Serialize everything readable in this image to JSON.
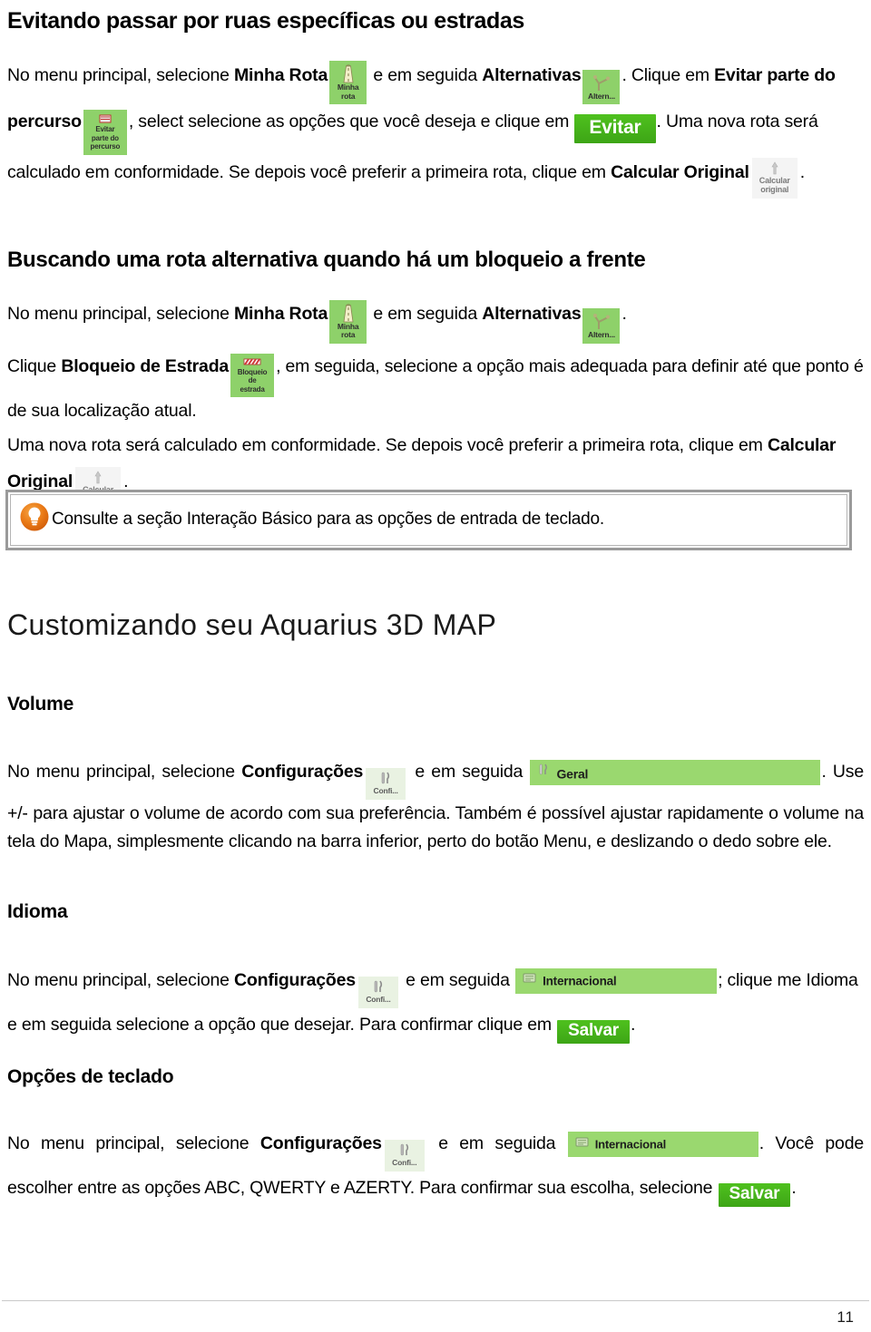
{
  "document": {
    "page_number": "11"
  },
  "colors": {
    "icon_green": "#8ed16a",
    "bar_green": "#9ad86f",
    "button_green": "#3da516",
    "tip_orange": "#e8751a",
    "icon_gray": "#f4f4f4",
    "rule_gray": "#c9c9c9"
  },
  "section1": {
    "heading": "Evitando passar por ruas específicas ou estradas",
    "p1_a": "No menu principal, selecione ",
    "p1_b_minha_rota": "Minha Rota",
    "p1_c": " e em seguida ",
    "p1_d_alternativas": "Alternativas",
    "p1_e": ". Clique em ",
    "p1_f_evitar_parte": "Evitar parte do percurso",
    "p1_g": ", select selecione as opções que você deseja e clique em ",
    "p1_h": ". Uma nova rota será calculado em conformidade. Se depois você preferir a primeira rota, clique em ",
    "p1_i_calcular": "Calcular Original",
    "p1_j": "."
  },
  "section2": {
    "heading": "Buscando uma rota alternativa quando há um bloqueio a frente",
    "p1_a": "No menu principal, selecione ",
    "p1_b_minha_rota": "Minha Rota",
    "p1_c": " e em seguida ",
    "p1_d_alternativas": "Alternativas",
    "p1_e": ".",
    "p2_a": "Clique ",
    "p2_b_bloqueio": "Bloqueio de Estrada",
    "p2_c": ", em seguida, selecione a opção mais adequada para definir até que ponto é de sua localização atual.",
    "p3": "Uma nova rota será calculado em conformidade. Se depois você preferir a primeira rota, clique em ",
    "p3_b_calcular": "Calcular Original",
    "p3_c": "."
  },
  "tip": {
    "icon": "lightbulb-icon",
    "text": "Consulte a seção Interação Básico para as opções de entrada de teclado."
  },
  "section3": {
    "heading": "Customizando seu Aquarius 3D MAP"
  },
  "volume": {
    "heading": "Volume",
    "p_a": "No menu principal, selecione ",
    "p_b_config": "Configurações",
    "p_c": " e em seguida ",
    "p_d": ". Use +/- para ajustar o volume de acordo com sua preferência. Também é possível ajustar rapidamente o volume na tela do Mapa, simplesmente clicando na barra inferior, perto do botão Menu, e deslizando o dedo sobre ele."
  },
  "idioma": {
    "heading": "Idioma",
    "p_a": "No menu principal, selecione ",
    "p_b_config": "Configurações",
    "p_c": " e em seguida ",
    "p_d": "; clique me Idioma e em seguida selecione a opção que desejar. Para confirmar clique em ",
    "p_e": "."
  },
  "teclado": {
    "heading": "Opções de teclado",
    "p_a": "No menu principal, selecione ",
    "p_b_config": "Configurações",
    "p_c": " e em seguida ",
    "p_d": ". Você pode escolher entre as opções ABC, QWERTY e AZERTY. Para confirmar sua escolha, selecione ",
    "p_e": "."
  },
  "icons": {
    "minha_rota": {
      "name": "minha-rota-icon",
      "caption_line1": "Minha",
      "caption_line2": "rota"
    },
    "alternativas": {
      "name": "alternativas-icon",
      "caption_line1": "Altern...",
      "caption_line2": ""
    },
    "evitar_parte": {
      "name": "evitar-parte-do-percurso-icon",
      "caption_line1": "Evitar",
      "caption_line2": "parte do",
      "caption_line3": "percurso"
    },
    "bloqueio_estrada": {
      "name": "bloqueio-de-estrada-icon",
      "caption_line1": "Bloqueio",
      "caption_line2": "de",
      "caption_line3": "estrada"
    },
    "calcular_original": {
      "name": "calcular-original-icon",
      "caption_line1": "Calcular",
      "caption_line2": "original"
    },
    "configuracoes": {
      "name": "configuracoes-icon",
      "caption_line1": "Confi..."
    },
    "geral_bar": {
      "name": "geral-menu-bar",
      "label": "Geral"
    },
    "internacional_bar": {
      "name": "internacional-menu-bar",
      "label": "Internacional"
    }
  },
  "buttons": {
    "evitar": "Evitar",
    "salvar": "Salvar"
  }
}
